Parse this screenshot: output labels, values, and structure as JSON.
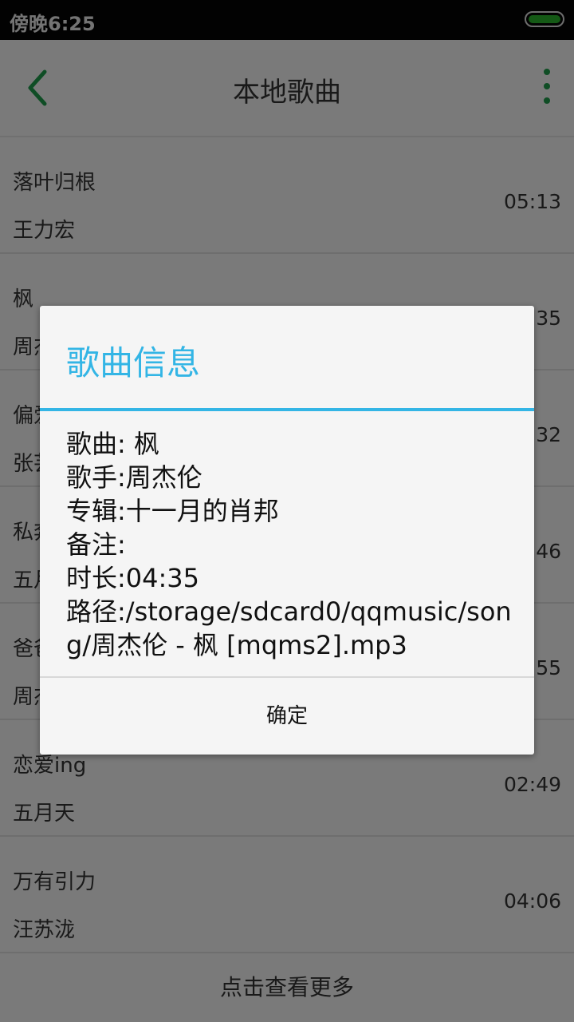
{
  "status_bar": {
    "time": "傍晚6:25"
  },
  "app_bar": {
    "title": "本地歌曲"
  },
  "songs": [
    {
      "title": "落叶归根",
      "artist": "王力宏",
      "duration": "05:13"
    },
    {
      "title": "枫",
      "artist": "周杰伦",
      "duration": "04:35"
    },
    {
      "title": "偏爱",
      "artist": "张芸京",
      "duration": "03:32"
    },
    {
      "title": "私奔",
      "artist": "五月天",
      "duration": "04:46"
    },
    {
      "title": "爸爸妈妈",
      "artist": "周杰伦",
      "duration": "03:55"
    },
    {
      "title": "恋爱ing",
      "artist": "五月天",
      "duration": "02:49"
    },
    {
      "title": "万有引力",
      "artist": "汪苏泷",
      "duration": "04:06"
    }
  ],
  "load_more": "点击查看更多",
  "dialog": {
    "title": "歌曲信息",
    "song_line": "歌曲: 枫",
    "artist_line": "歌手:周杰伦",
    "album_line": "专辑:十一月的肖邦",
    "note_line": "备注:",
    "duration_line": "时长:04:35",
    "path_line": "路径:/storage/sdcard0/qqmusic/song/周杰伦 - 枫 [mqms2].mp3",
    "confirm_label": "确定"
  },
  "colors": {
    "accent": "#33b5e5",
    "brand_green": "#1f9b4a"
  }
}
